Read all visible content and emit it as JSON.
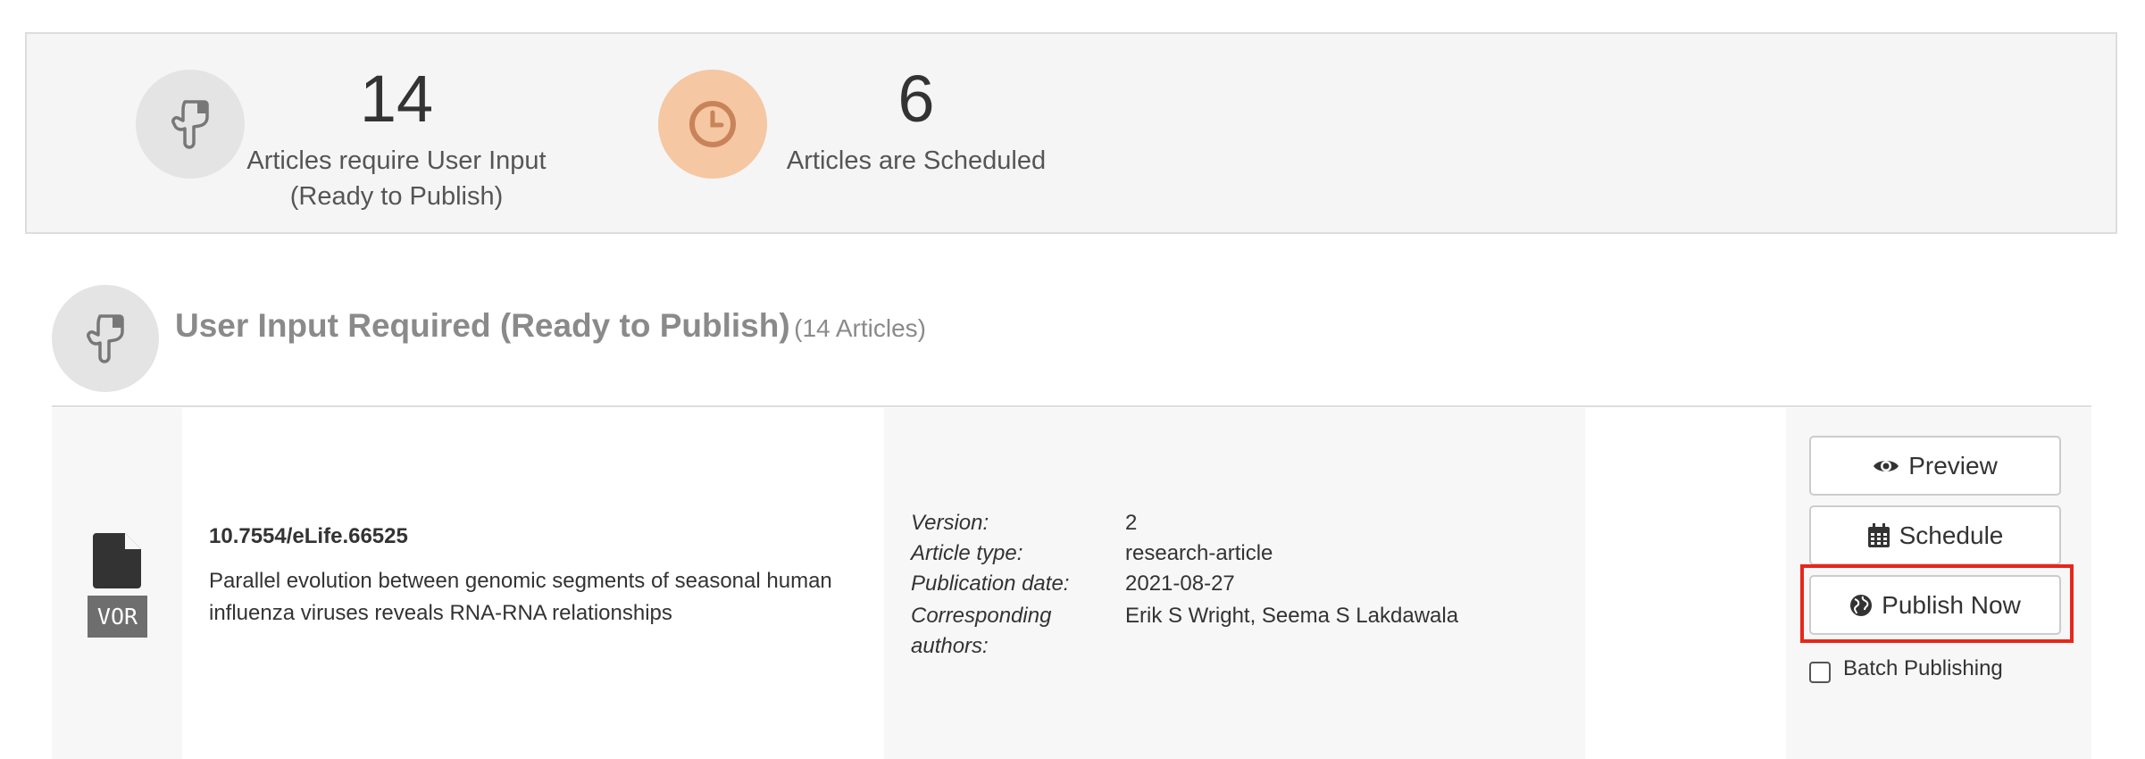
{
  "colors": {
    "panel_bg": "#f5f5f5",
    "icon_circle_grey": "#e4e4e4",
    "icon_circle_orange": "#f5c7a2",
    "clock_icon": "#c9835a",
    "highlight": "#e8261a",
    "badge_bg": "#6e6e6e"
  },
  "summary": {
    "user_input": {
      "icon": "hand-pointing-down-icon",
      "count": "14",
      "label_line1": "Articles require User Input",
      "label_line2": "(Ready to Publish)"
    },
    "scheduled": {
      "icon": "clock-icon",
      "count": "6",
      "label": "Articles are Scheduled"
    }
  },
  "section": {
    "icon": "hand-pointing-down-icon",
    "title": "User Input Required (Ready to Publish)",
    "count_text": "(14 Articles)"
  },
  "article": {
    "file_icon": "file-icon",
    "badge": "VOR",
    "doi": "10.7554/eLife.66525",
    "title": "Parallel evolution between genomic segments of seasonal human influenza viruses reveals RNA-RNA relationships",
    "meta": {
      "version_label": "Version:",
      "version": "2",
      "type_label": "Article type:",
      "type": "research-article",
      "date_label": "Publication date:",
      "date": "2021-08-27",
      "authors_label_line1": "Corresponding",
      "authors_label_line2": "authors:",
      "authors": "Erik S Wright, Seema S Lakdawala"
    },
    "actions": {
      "preview": "Preview",
      "schedule": "Schedule",
      "publish_now": "Publish Now",
      "batch_publishing": "Batch Publishing",
      "batch_checked": false
    }
  }
}
